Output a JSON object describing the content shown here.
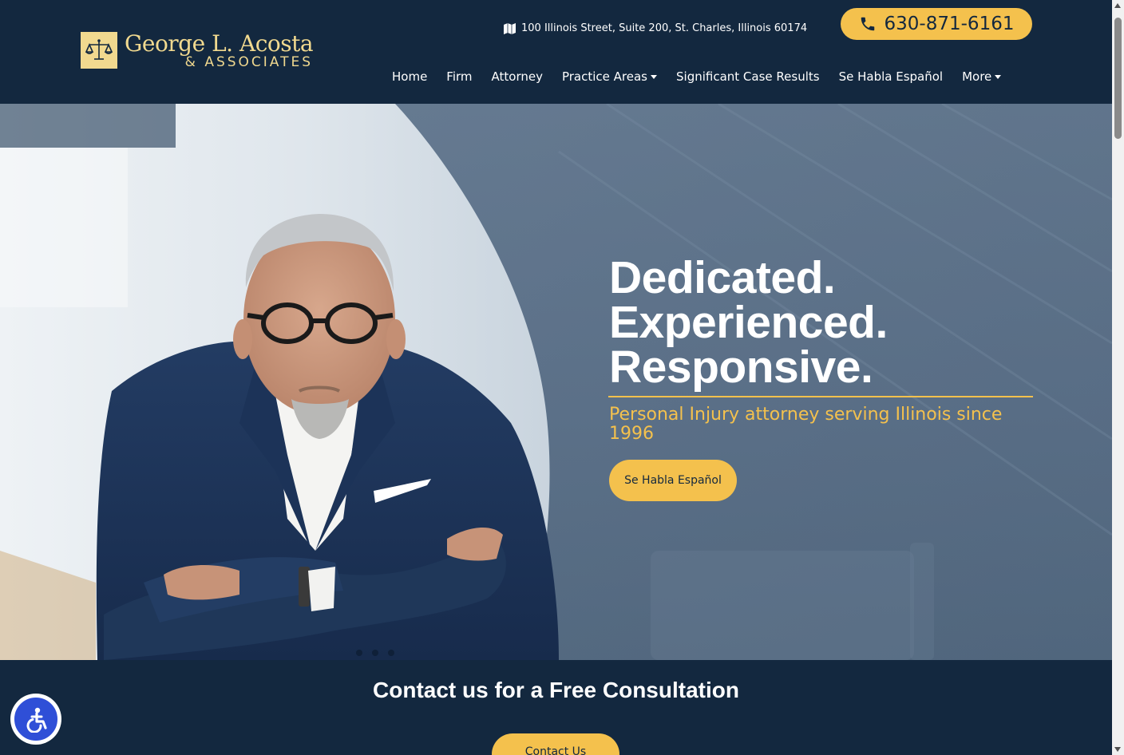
{
  "header": {
    "logo": {
      "name": "George L. Acosta",
      "sub": "& ASSOCIATES",
      "icon": "scales-of-justice-icon"
    },
    "address": {
      "icon": "map-icon",
      "text": "100 Illinois Street, Suite 200, St. Charles, Illinois 60174"
    },
    "phone": {
      "icon": "phone-icon",
      "label": "630-871-6161"
    },
    "nav": [
      {
        "label": "Home"
      },
      {
        "label": "Firm"
      },
      {
        "label": "Attorney"
      },
      {
        "label": "Practice Areas",
        "dropdown": true
      },
      {
        "label": "Significant Case Results"
      },
      {
        "label": "Se Habla Español"
      },
      {
        "label": "More",
        "dropdown": true
      }
    ]
  },
  "hero": {
    "headline": [
      "Dedicated.",
      "Experienced.",
      "Responsive."
    ],
    "tagline": "Personal Injury attorney serving Illinois since 1996",
    "button": "Se Habla Español"
  },
  "contact": {
    "title": "Contact us for a Free Consultation",
    "button": "Contact Us"
  },
  "accessibility": {
    "icon": "accessibility-icon"
  },
  "colors": {
    "navy": "#13283f",
    "gold": "#f4c14d",
    "logo_gold": "#f1d98f",
    "hero_bg": "#5a6f88",
    "a11y_blue": "#2f4fd7"
  }
}
